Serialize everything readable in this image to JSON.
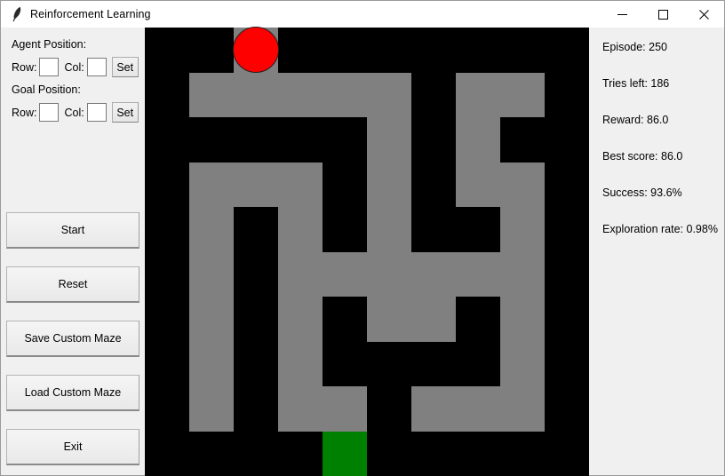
{
  "window": {
    "title": "Reinforcement Learning",
    "app_icon": "feather-icon",
    "minimize_label": "Minimize",
    "maximize_label": "Maximize",
    "close_label": "Close"
  },
  "controls": {
    "agent_section_label": "Agent Position:",
    "goal_section_label": "Goal Position:",
    "row_label": "Row:",
    "col_label": "Col:",
    "set_label": "Set",
    "agent_row_value": "",
    "agent_col_value": "",
    "goal_row_value": "",
    "goal_col_value": "",
    "buttons": [
      {
        "label": "Start"
      },
      {
        "label": "Reset"
      },
      {
        "label": "Save Custom Maze"
      },
      {
        "label": "Load Custom Maze"
      },
      {
        "label": "Exit"
      }
    ]
  },
  "stats": [
    {
      "text": "Episode: 250"
    },
    {
      "text": "Tries left: 186"
    },
    {
      "text": "Reward: 86.0"
    },
    {
      "text": "Best score: 86.0"
    },
    {
      "text": "Success: 93.6%"
    },
    {
      "text": "Exploration rate: 0.98%"
    }
  ],
  "maze": {
    "rows": 10,
    "cols": 10,
    "wall_color": "#000000",
    "path_color": "#808080",
    "goal_color": "#008000",
    "agent_color": "#ff0000",
    "agent_position": {
      "row": 0,
      "col": 2
    },
    "goal_position": {
      "row": 9,
      "col": 4
    },
    "grid": [
      [
        0,
        0,
        1,
        0,
        0,
        0,
        0,
        0,
        0,
        0
      ],
      [
        0,
        1,
        1,
        1,
        1,
        1,
        0,
        1,
        1,
        0
      ],
      [
        0,
        0,
        0,
        0,
        0,
        1,
        0,
        1,
        0,
        0
      ],
      [
        0,
        1,
        1,
        1,
        0,
        1,
        0,
        1,
        1,
        0
      ],
      [
        0,
        1,
        0,
        1,
        0,
        1,
        0,
        0,
        1,
        0
      ],
      [
        0,
        1,
        0,
        1,
        1,
        1,
        1,
        1,
        1,
        0
      ],
      [
        0,
        1,
        0,
        1,
        0,
        1,
        1,
        0,
        1,
        0
      ],
      [
        0,
        1,
        0,
        1,
        0,
        0,
        0,
        0,
        1,
        0
      ],
      [
        0,
        1,
        0,
        1,
        1,
        0,
        1,
        1,
        1,
        0
      ],
      [
        0,
        0,
        0,
        0,
        2,
        0,
        0,
        0,
        0,
        0
      ]
    ]
  }
}
